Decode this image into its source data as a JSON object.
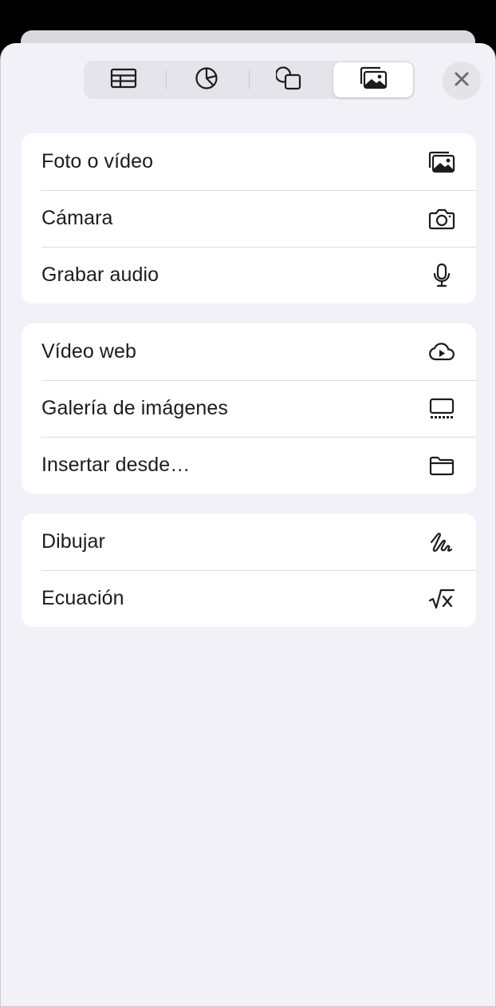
{
  "tabs": [
    {
      "icon": "table-icon",
      "selected": false
    },
    {
      "icon": "chart-icon",
      "selected": false
    },
    {
      "icon": "shapes-icon",
      "selected": false
    },
    {
      "icon": "media-icon",
      "selected": true
    }
  ],
  "close": {
    "icon": "close-icon"
  },
  "groups": [
    {
      "items": [
        {
          "label": "Foto o vídeo",
          "icon": "photo-library-icon"
        },
        {
          "label": "Cámara",
          "icon": "camera-icon"
        },
        {
          "label": "Grabar audio",
          "icon": "microphone-icon"
        }
      ]
    },
    {
      "items": [
        {
          "label": "Vídeo web",
          "icon": "web-video-icon"
        },
        {
          "label": "Galería de imágenes",
          "icon": "image-gallery-icon"
        },
        {
          "label": "Insertar desde…",
          "icon": "folder-icon"
        }
      ]
    },
    {
      "items": [
        {
          "label": "Dibujar",
          "icon": "draw-icon"
        },
        {
          "label": "Ecuación",
          "icon": "equation-icon"
        }
      ]
    }
  ],
  "colors": {
    "sheet_background": "#f2f1f7",
    "card_background": "#ffffff",
    "text": "#1c1c1e",
    "separator": "#dcdce0"
  }
}
